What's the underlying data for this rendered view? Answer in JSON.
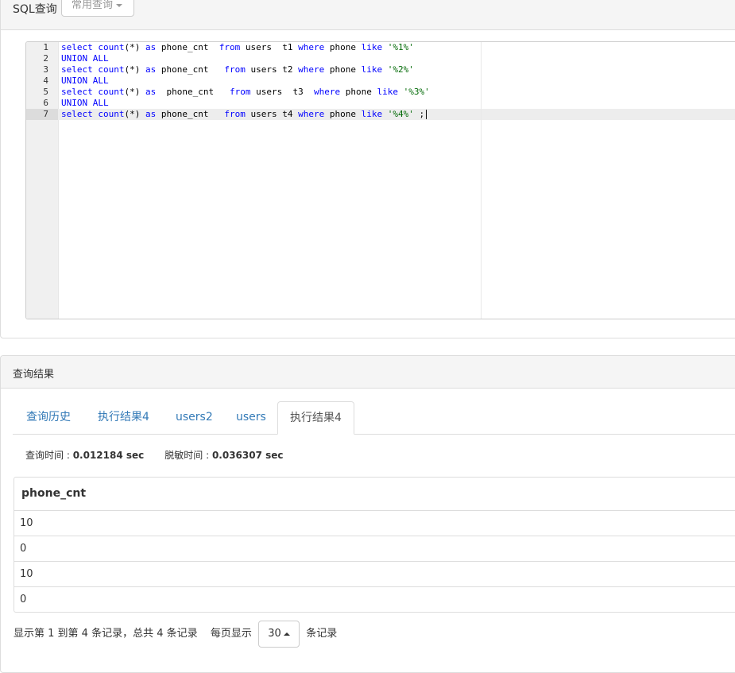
{
  "sql_panel": {
    "title": "SQL查询",
    "common_query_label": "常用查询"
  },
  "editor": {
    "line_numbers": [
      "1",
      "2",
      "3",
      "4",
      "5",
      "6",
      "7"
    ],
    "lines": [
      "select count(*) as phone_cnt  from users  t1 where phone like '%1%'",
      "UNION ALL",
      "select count(*) as phone_cnt   from users t2 where phone like '%2%'",
      "UNION ALL",
      "select count(*) as  phone_cnt   from users  t3  where phone like '%3%'",
      "UNION ALL",
      "select count(*) as phone_cnt   from users t4 where phone like '%4%' ;"
    ],
    "active_line": 7,
    "colors": {
      "keyword": "#0000ff",
      "string": "#036a07"
    }
  },
  "result_panel": {
    "title": "查询结果",
    "tabs": [
      {
        "label": "查询历史",
        "active": false
      },
      {
        "label": "执行结果4",
        "active": false
      },
      {
        "label": "users2",
        "active": false
      },
      {
        "label": "users",
        "active": false
      },
      {
        "label": "执行结果4",
        "active": true
      }
    ],
    "timing": {
      "query_label": "查询时间 : ",
      "query_value": "0.012184 sec",
      "mask_label": "脱敏时间 : ",
      "mask_value": "0.036307 sec"
    },
    "table": {
      "columns": [
        "phone_cnt"
      ],
      "rows": [
        [
          "10"
        ],
        [
          "0"
        ],
        [
          "10"
        ],
        [
          "0"
        ]
      ]
    },
    "pagination": {
      "summary": "显示第 1 到第 4 条记录，总共 4 条记录",
      "per_page_label": "每页显示",
      "page_size": "30",
      "suffix": "条记录"
    },
    "link_color": "#337ab7"
  }
}
